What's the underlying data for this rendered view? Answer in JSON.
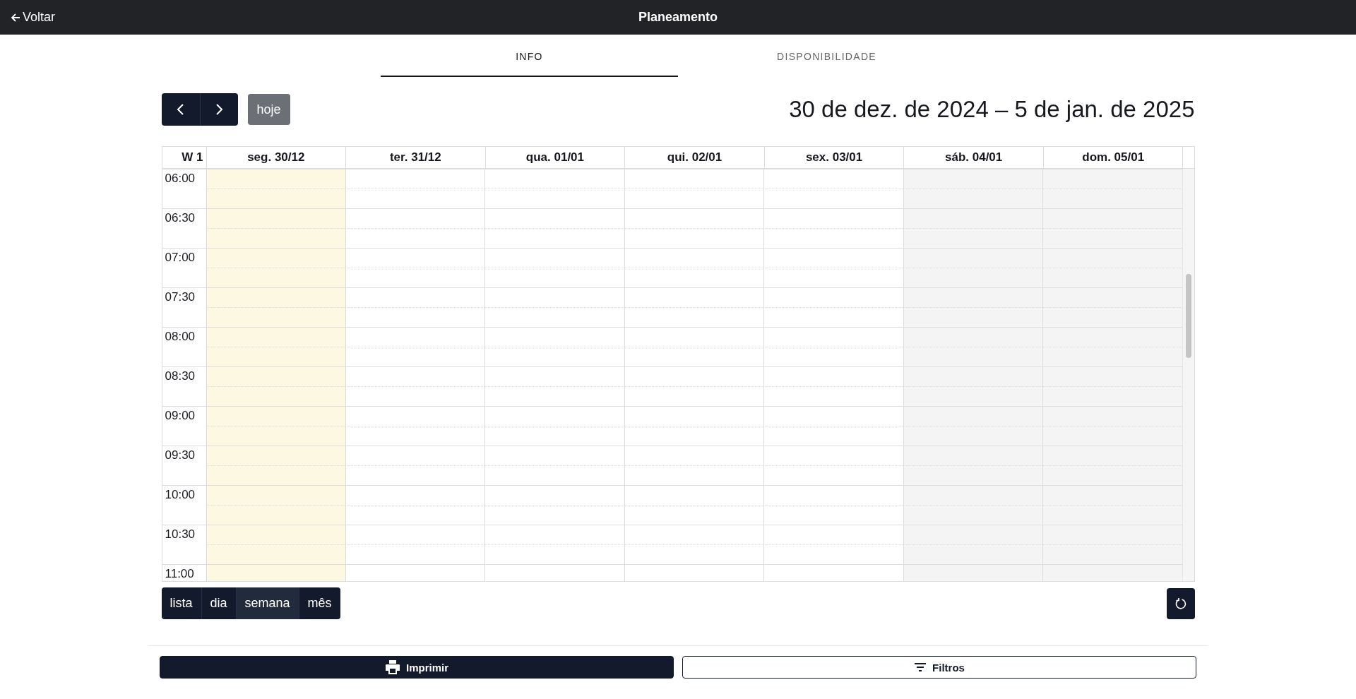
{
  "top_bar": {
    "back_label": "Voltar",
    "title": "Planeamento"
  },
  "tabs": [
    {
      "label": "INFO",
      "selected": true
    },
    {
      "label": "DISPONIBILIDADE",
      "selected": false
    }
  ],
  "toolbar": {
    "today_label": "hoje",
    "range_title": "30 de dez. de 2024 – 5 de jan. de 2025"
  },
  "calendar": {
    "week_label": "W 1",
    "days": [
      {
        "label": "seg. 30/12",
        "kind": "today"
      },
      {
        "label": "ter. 31/12",
        "kind": "weekday"
      },
      {
        "label": "qua. 01/01",
        "kind": "weekday"
      },
      {
        "label": "qui. 02/01",
        "kind": "weekday"
      },
      {
        "label": "sex. 03/01",
        "kind": "weekday"
      },
      {
        "label": "sáb. 04/01",
        "kind": "weekend"
      },
      {
        "label": "dom. 05/01",
        "kind": "weekend"
      }
    ],
    "times": [
      "06:00",
      "06:30",
      "07:00",
      "07:30",
      "08:00",
      "08:30",
      "09:00",
      "09:30",
      "10:00",
      "10:30",
      "11:00"
    ]
  },
  "views": [
    {
      "label": "lista",
      "selected": false
    },
    {
      "label": "dia",
      "selected": false
    },
    {
      "label": "semana",
      "selected": true
    },
    {
      "label": "mês",
      "selected": false
    }
  ],
  "actions": {
    "print_label": "Imprimir",
    "filter_label": "Filtros"
  }
}
